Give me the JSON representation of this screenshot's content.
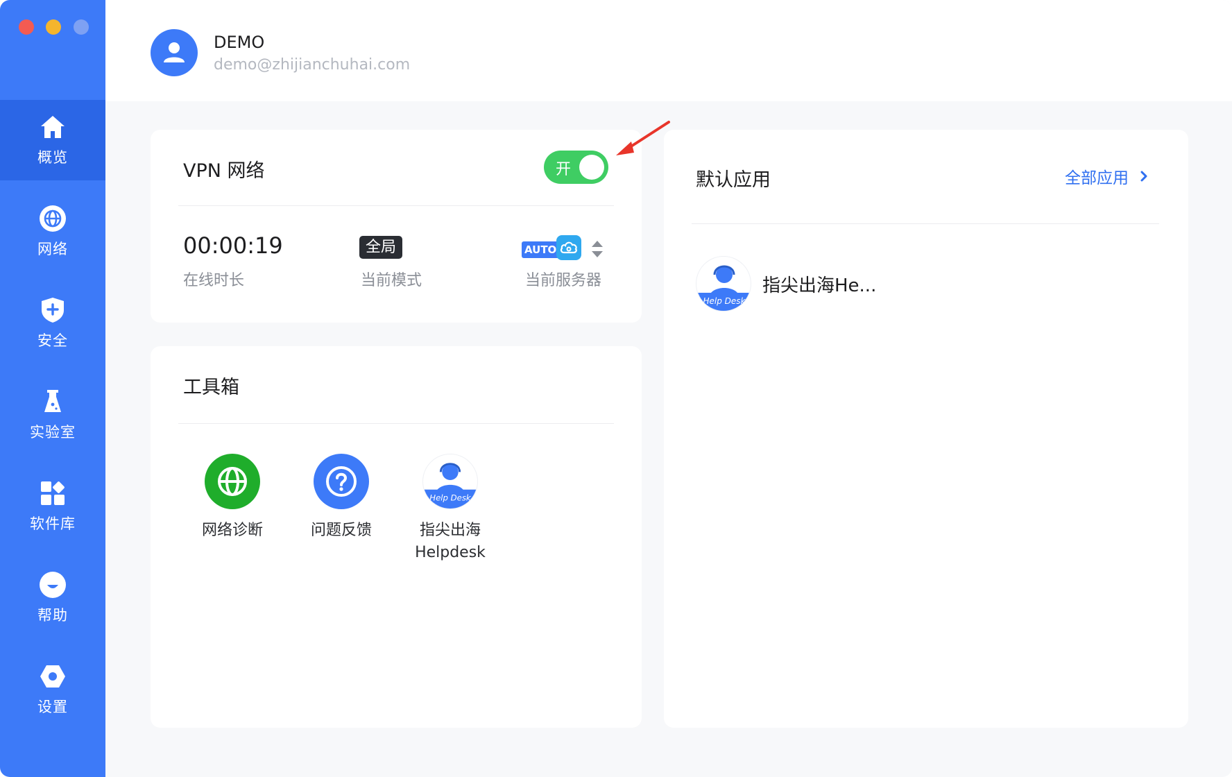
{
  "sidebar": {
    "items": [
      {
        "label": "概览",
        "icon": "home-icon",
        "active": true
      },
      {
        "label": "网络",
        "icon": "globe-icon"
      },
      {
        "label": "安全",
        "icon": "shield-icon"
      },
      {
        "label": "实验室",
        "icon": "flask-icon"
      },
      {
        "label": "软件库",
        "icon": "apps-grid-icon"
      },
      {
        "label": "帮助",
        "icon": "smiley-icon"
      },
      {
        "label": "设置",
        "icon": "settings-hexagon-icon"
      }
    ]
  },
  "header": {
    "user_name": "DEMO",
    "user_email": "demo@zhijianchuhai.com"
  },
  "vpn": {
    "title": "VPN 网络",
    "toggle_label": "开",
    "toggle_on": true,
    "online_duration": "00:00:19",
    "online_duration_label": "在线时长",
    "mode": "全局",
    "mode_label": "当前模式",
    "server_auto": "AUTO",
    "server_label": "当前服务器"
  },
  "toolbox": {
    "title": "工具箱",
    "tools": [
      {
        "label": "网络诊断",
        "icon": "network-diagnose-icon",
        "color": "#1fad2b"
      },
      {
        "label": "问题反馈",
        "icon": "feedback-question-icon",
        "color": "#3d7af8"
      },
      {
        "label": "指尖出海\nHelpdesk",
        "icon": "helpdesk-icon",
        "color": "#3d7af8",
        "badge_text": "Help Desk"
      }
    ]
  },
  "default_apps": {
    "title": "默认应用",
    "all_apps_link": "全部应用",
    "items": [
      {
        "name": "指尖出海He...",
        "icon": "helpdesk-icon",
        "badge_text": "Help Desk"
      }
    ]
  },
  "colors": {
    "sidebar_bg": "#3d7af8",
    "sidebar_active": "#2b66e6",
    "toggle_on": "#3fcd63",
    "link": "#2f6ff0",
    "annotation_arrow": "#e8352a"
  }
}
